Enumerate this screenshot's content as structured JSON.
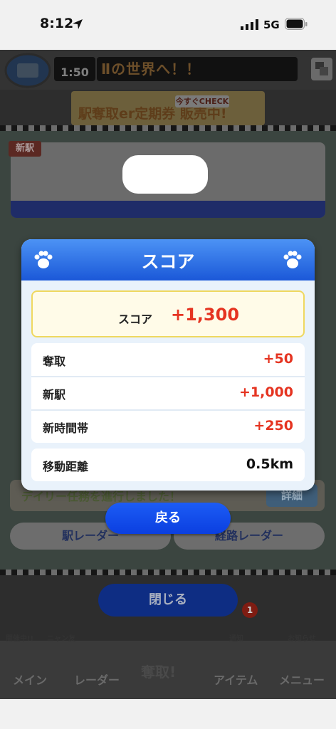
{
  "status_bar": {
    "time": "8:12",
    "network": "5G"
  },
  "game": {
    "timer": "1:50",
    "marquee": "Ⅱの世界へ！！",
    "banner": "駅奪取er定期券 販売中!",
    "banner_check": "今すぐCHECK",
    "new_station_tag": "新駅",
    "daily_message": "デイリー任務を進行しました！",
    "detail_button": "詳細",
    "station_radar": "駅レーダー",
    "route_radar": "経路レーダー",
    "close_button": "閉じる",
    "notify_count": "1",
    "small_labels": {
      "holding": "開催中!!",
      "nyan": "ニャン友",
      "notify": "通知",
      "news": "お知らせ"
    },
    "tabs": {
      "main": "メイン",
      "radar": "レーダー",
      "dasshu": "奪取!",
      "item": "アイテム",
      "menu": "メニュー"
    }
  },
  "dialog": {
    "title": "スコア",
    "total_label": "スコア",
    "total_value": "+1,300",
    "rows": [
      {
        "label": "奪取",
        "value": "+50"
      },
      {
        "label": "新駅",
        "value": "+1,000"
      },
      {
        "label": "新時間帯",
        "value": "+250"
      }
    ],
    "distance": {
      "label": "移動距離",
      "value": "0.5km"
    },
    "back_button": "戻る"
  },
  "colors": {
    "accent_blue": "#1b58d8",
    "score_red": "#e53421"
  }
}
